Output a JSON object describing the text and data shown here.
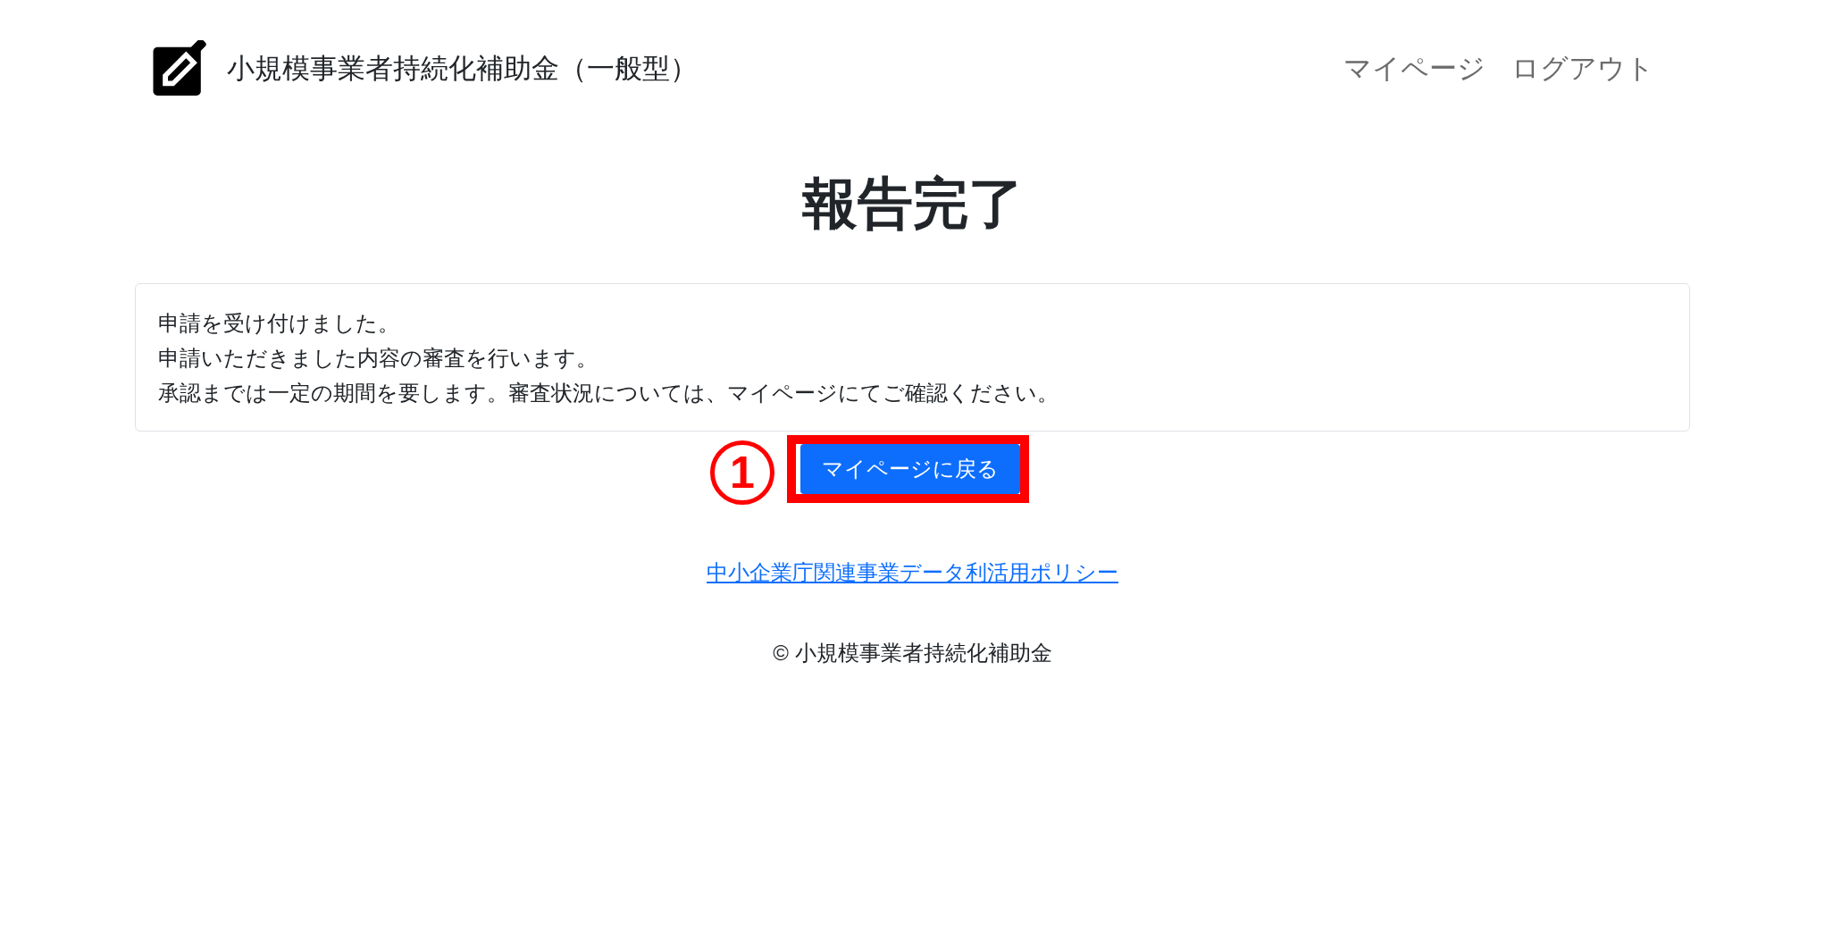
{
  "header": {
    "title": "小規模事業者持続化補助金（一般型）",
    "nav": [
      "マイページ",
      "ログアウト"
    ]
  },
  "page_title": "報告完了",
  "message": {
    "lines": [
      "申請を受け付けました。",
      "申請いただきました内容の審査を行います。",
      "承認までは一定の期間を要します。審査状況については、マイページにてご確認ください。"
    ]
  },
  "annotation": {
    "step": "1"
  },
  "back_button": {
    "label": "マイページに戻る"
  },
  "policy_link": "中小企業庁関連事業データ利活用ポリシー",
  "footer": {
    "copyright": "© 小規模事業者持続化補助金"
  }
}
